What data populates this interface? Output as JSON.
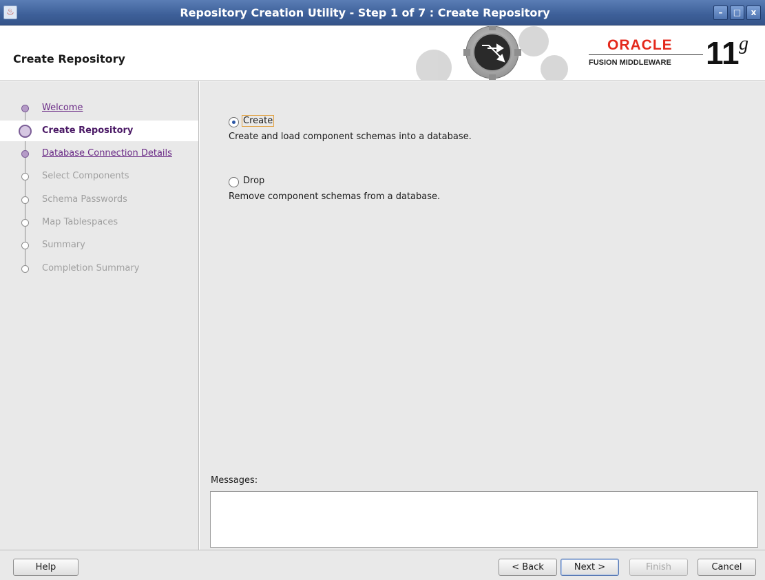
{
  "window": {
    "title": "Repository Creation Utility - Step 1 of 7 : Create Repository",
    "app_icon_glyph": "♨",
    "controls": {
      "minimize_glyph": "–",
      "maximize_glyph": "□",
      "close_glyph": "x"
    }
  },
  "header": {
    "page_title": "Create Repository",
    "brand": {
      "oracle": "ORACLE",
      "fusion": "FUSION MIDDLEWARE",
      "version_number": "11",
      "version_suffix": "g"
    }
  },
  "sidebar": {
    "items": [
      {
        "label": "Welcome",
        "state": "visited"
      },
      {
        "label": "Create Repository",
        "state": "active"
      },
      {
        "label": "Database Connection Details",
        "state": "visited"
      },
      {
        "label": "Select Components",
        "state": "disabled"
      },
      {
        "label": "Schema Passwords",
        "state": "disabled"
      },
      {
        "label": "Map Tablespaces",
        "state": "disabled"
      },
      {
        "label": "Summary",
        "state": "disabled"
      },
      {
        "label": "Completion Summary",
        "state": "disabled"
      }
    ]
  },
  "main": {
    "options": [
      {
        "label": "Create",
        "description": "Create and load component schemas into a database.",
        "selected": true
      },
      {
        "label": "Drop",
        "description": "Remove component schemas from a database.",
        "selected": false
      }
    ],
    "messages_label": "Messages:",
    "messages_value": ""
  },
  "footer": {
    "help": "Help",
    "back": "< Back",
    "next": "Next >",
    "finish": "Finish",
    "cancel": "Cancel"
  },
  "colors": {
    "titlebar": "#3d5f98",
    "visited_link": "#6a2a86",
    "oracle_red": "#e4291c",
    "panel_bg": "#e9e9e9"
  },
  "icons": [
    "app-icon",
    "gears-icon",
    "minimize-icon",
    "maximize-icon",
    "close-icon"
  ]
}
